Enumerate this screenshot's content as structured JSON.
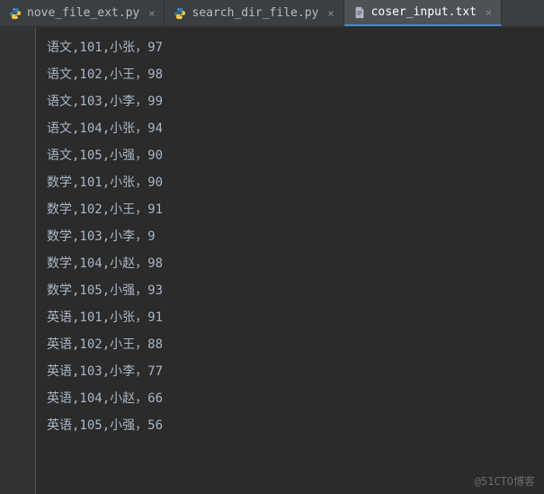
{
  "tabs": [
    {
      "label": "nove_file_ext.py",
      "type": "python",
      "active": false
    },
    {
      "label": "search_dir_file.py",
      "type": "python",
      "active": false
    },
    {
      "label": "coser_input.txt",
      "type": "text",
      "active": true
    }
  ],
  "close_glyph": "×",
  "lines": [
    "语文,101,小张，97",
    "语文,102,小王，98",
    "语文,103,小李，99",
    "语文,104,小张，94",
    "语文,105,小强，90",
    "数学,101,小张，90",
    "数学,102,小王，91",
    "数学,103,小李，9",
    "数学,104,小赵，98",
    "数学,105,小强，93",
    "英语,101,小张，91",
    "英语,102,小王，88",
    "英语,103,小李，77",
    "英语,104,小赵，66",
    "英语,105,小强，56"
  ],
  "watermark": "@51CTO博客"
}
